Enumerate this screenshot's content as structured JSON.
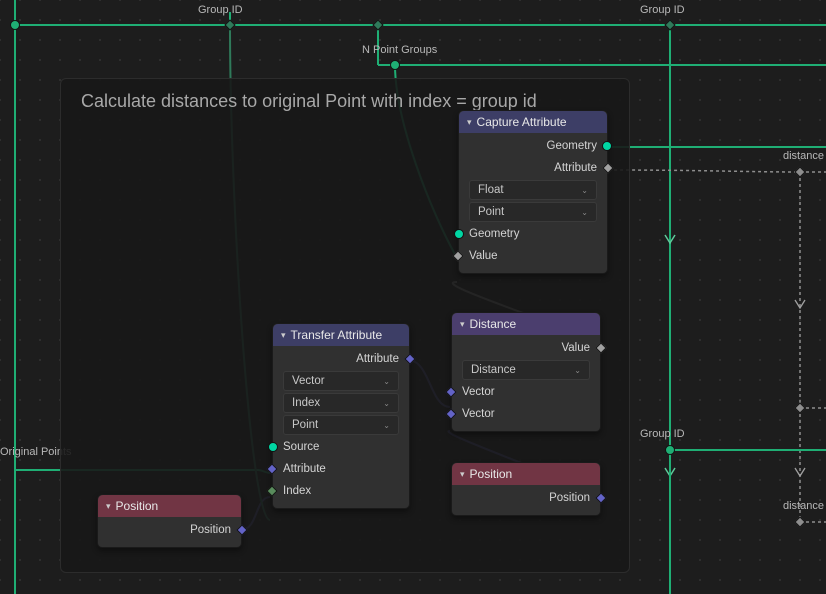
{
  "frame": {
    "title": "Calculate distances to original Point with index = group id"
  },
  "reroute_labels": {
    "group_id_left": "Group ID",
    "group_id_right_top": "Group ID",
    "n_point_groups": "N Point Groups",
    "original_points": "Original Points",
    "group_id_right_mid": "Group ID",
    "distance_top": "distance",
    "distance_bottom": "distance"
  },
  "nodes": {
    "capture": {
      "title": "Capture Attribute",
      "out_geometry": "Geometry",
      "out_attribute": "Attribute",
      "sel_type": "Float",
      "sel_domain": "Point",
      "in_geometry": "Geometry",
      "in_value": "Value"
    },
    "distance": {
      "title": "Distance",
      "out_value": "Value",
      "sel_mode": "Distance",
      "in_vec_a": "Vector",
      "in_vec_b": "Vector"
    },
    "position2": {
      "title": "Position",
      "out_position": "Position"
    },
    "transfer": {
      "title": "Transfer Attribute",
      "out_attribute": "Attribute",
      "sel_type": "Vector",
      "sel_mapping": "Index",
      "sel_domain": "Point",
      "in_source": "Source",
      "in_attribute": "Attribute",
      "in_index": "Index"
    },
    "position1": {
      "title": "Position",
      "out_position": "Position"
    }
  }
}
